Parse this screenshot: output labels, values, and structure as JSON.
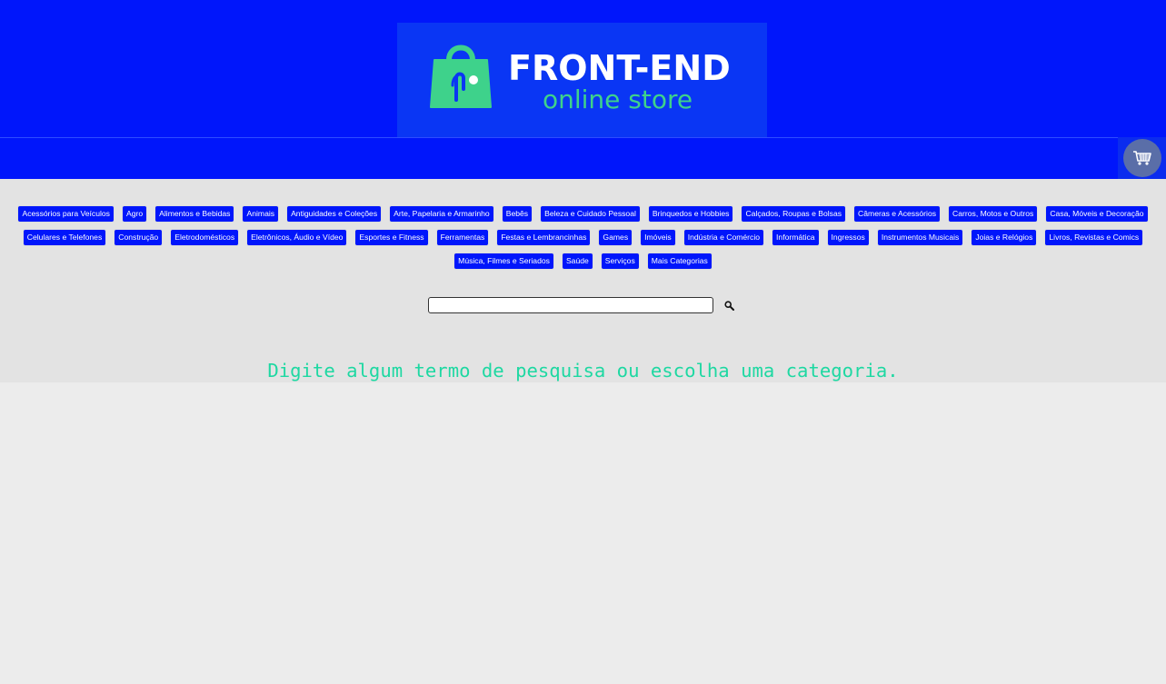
{
  "header": {
    "logo_title": "FRONT-END",
    "logo_subtitle": "online store"
  },
  "colors": {
    "header_bg": "#0016fb",
    "logo_bg": "#0a36f4",
    "logo_green": "#3ed28b",
    "content_bg": "#e3e3e3",
    "message_color": "#1ed8a2"
  },
  "cart": {
    "icon": "shopping-cart-icon"
  },
  "categories": {
    "row1": [
      "Acessórios para Veículos",
      "Agro",
      "Alimentos e Bebidas",
      "Animais",
      "Antiguidades e Coleções",
      "Arte, Papelaria e Armarinho",
      "Bebês",
      "Beleza e Cuidado Pessoal",
      "Brinquedos e Hobbies",
      "Calçados, Roupas e Bolsas",
      "Câmeras e Acessórios",
      "Carros, Motos e Outros",
      "Casa, Móveis e Decoração"
    ],
    "row2": [
      "Celulares e Telefones",
      "Construção",
      "Eletrodomésticos",
      "Eletrônicos, Áudio e Vídeo",
      "Esportes e Fitness",
      "Ferramentas",
      "Festas e Lembrancinhas",
      "Games",
      "Imóveis",
      "Indústria e Comércio",
      "Informática",
      "Ingressos",
      "Instrumentos Musicais",
      "Joias e Relógios",
      "Livros, Revistas e Comics"
    ],
    "row3": [
      "Música, Filmes e Seriados",
      "Saúde",
      "Serviços",
      "Mais Categorias"
    ]
  },
  "search": {
    "value": "",
    "icon": "search-icon"
  },
  "message": "Digite algum termo de pesquisa ou escolha uma categoria."
}
